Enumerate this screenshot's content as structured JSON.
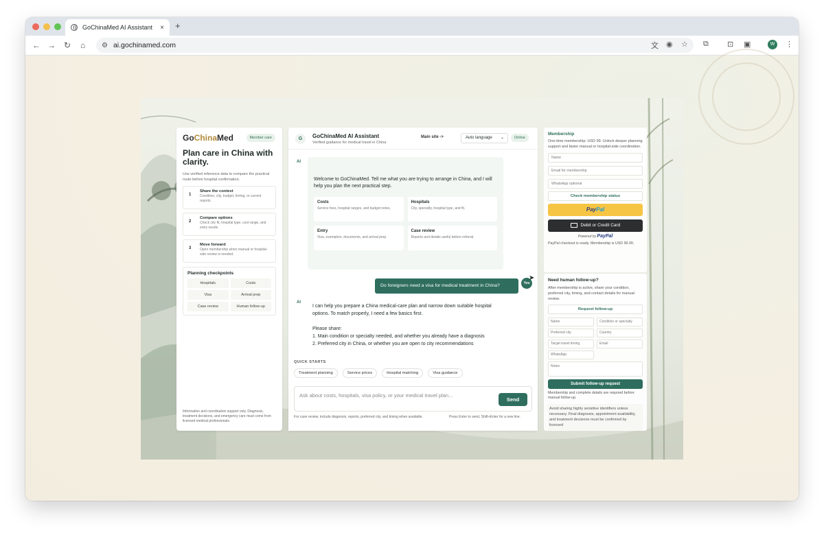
{
  "browser": {
    "tab_title": "GoChinaMed AI Assistant",
    "tab_close": "×",
    "new_tab": "+",
    "url": "ai.gochinamed.com",
    "profile_initial": "W"
  },
  "left": {
    "brand_part1": "Go",
    "brand_part2": "China",
    "brand_part3": "Med",
    "member_pill": "Member care",
    "hero": "Plan care in China with clarity.",
    "hero_sub": "Use verified reference data to compare the practical route before hospital confirmation.",
    "steps": [
      {
        "num": "1",
        "title": "Share the context",
        "desc": "Condition, city, budget, timing, or current reports."
      },
      {
        "num": "2",
        "title": "Compare options",
        "desc": "Check city fit, hospital type, cost range, and entry needs."
      },
      {
        "num": "3",
        "title": "Move forward",
        "desc": "Open membership when manual or hospital-side review is needed."
      }
    ],
    "checkpoints_title": "Planning checkpoints",
    "checkpoints": [
      "Hospitals",
      "Costs",
      "Visa",
      "Arrival prep",
      "Case review",
      "Human follow-up"
    ],
    "footer": "Information and coordination support only. Diagnosis, treatment decisions, and emergency care must come from licensed medical professionals."
  },
  "chat": {
    "badge": "G",
    "title": "GoChinaMed AI Assistant",
    "subtitle": "Verified guidance for medical travel in China",
    "main_site": "Main site ->",
    "language": "Auto language",
    "status": "Online",
    "ai_label": "AI",
    "welcome": "Welcome to GoChinaMed. Tell me what you are trying to arrange in China, and I will help you plan the next practical step.",
    "tiles": [
      {
        "title": "Costs",
        "desc": "Service fees, hospital ranges, and budget notes."
      },
      {
        "title": "Hospitals",
        "desc": "City, specialty, hospital type, and fit."
      },
      {
        "title": "Entry",
        "desc": "Visa, exemption, documents, and arrival prep."
      },
      {
        "title": "Case review",
        "desc": "Reports and details useful before referral."
      }
    ],
    "user_message": "Do foreigners need a visa for medical treatment in China?",
    "user_label": "You",
    "reply_p1": "I can help you prepare a China medical-care plan and narrow down suitable hospital options. To match properly, I need a few basics first.",
    "reply_p2": "Please share:",
    "reply_l1": "1. Main condition or specialty needed, and whether you already have a diagnosis",
    "reply_l2": "2. Preferred city in China, or whether you are open to city recommendations",
    "quick_label": "QUICK STARTS",
    "quick": [
      "Treatment planning",
      "Service prices",
      "Hospital matching",
      "Visa guidance"
    ],
    "input_placeholder": "Ask about costs, hospitals, visa policy, or your medical travel plan...",
    "send": "Send",
    "hint_left": "For case review, include diagnosis, reports, preferred city, and timing when available.",
    "hint_right": "Press Enter to send, Shift+Enter for a new line."
  },
  "membership": {
    "title": "Membership",
    "desc": "One-time membership: USD 99. Unlock deeper planning support and faster manual or hospital-side coordination.",
    "name_ph": "Name",
    "email_ph": "Email for membership",
    "whatsapp_ph": "WhatsApp optional",
    "check_btn": "Check membership status",
    "paypal_a": "Pay",
    "paypal_b": "Pal",
    "card_btn": "Debit or Credit Card",
    "powered_by": "Powered by",
    "powered_brand": "PayPal",
    "ready": "PayPal checkout is ready. Membership is USD 99.00."
  },
  "followup": {
    "title": "Need human follow-up?",
    "desc": "After membership is active, share your condition, preferred city, timing, and contact details for manual review.",
    "request_btn": "Request follow-up",
    "fields": [
      "Name",
      "Condition or specialty",
      "Preferred city",
      "Country",
      "Target travel timing",
      "Email",
      "WhatsApp"
    ],
    "notes_ph": "Notes",
    "submit": "Submit follow-up request",
    "note": "Membership and complete details are required before manual follow-up.",
    "warning": "Avoid sharing highly sensitive identifiers unless necessary. Final diagnosis, appointment availability, and treatment decisions must be confirmed by licensed"
  }
}
